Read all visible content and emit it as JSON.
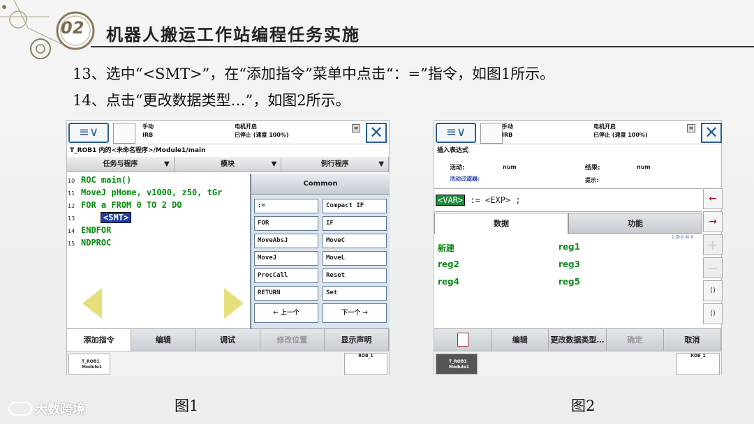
{
  "slide": {
    "section_number": "02",
    "title": "机器人搬运工作站编程任务实施",
    "steps": [
      "13、选中“<SMT>”，在“添加指令”菜单中点击“：=”指令，如图1所示。",
      "14、点击“更改数据类型…”，如图2所示。"
    ],
    "captions": [
      "图1",
      "图2"
    ],
    "watermark": "大数跨境"
  },
  "fig1": {
    "status_mode": "手动",
    "status_mode_sub": "IRB",
    "status_motor": "电机开启",
    "status_state": "已停止 (速度 100%)",
    "breadcrumb": "T_ROB1 内的<未命名程序>/Module1/main",
    "tabs": [
      "任务与程序",
      "模块",
      "例行程序"
    ],
    "code_lines": [
      {
        "num": "10",
        "text": "ROC main()"
      },
      {
        "num": "11",
        "text": " MoveJ pHome, v1000, z50, tGr"
      },
      {
        "num": "12",
        "text": " FOR a FROM 0 TO 2 DO"
      },
      {
        "num": "13",
        "text": "<SMT>"
      },
      {
        "num": "14",
        "text": " ENDFOR"
      },
      {
        "num": "15",
        "text": "NDPROC"
      }
    ],
    "popup_title": "Common",
    "commands": [
      ":=",
      "Compact IF",
      "FOR",
      "IF",
      "MoveAbsJ",
      "MoveC",
      "MoveJ",
      "MoveL",
      "ProcCall",
      "Reset",
      "RETURN",
      "Set"
    ],
    "prev_btn": "←  上一个",
    "next_btn": "下一个 →",
    "bottom": [
      "添加指令",
      "编辑",
      "调试",
      "修改位置",
      "显示声明"
    ],
    "task_label": "T_ROB1\nModule1",
    "robot_label": "ROB_1"
  },
  "fig2": {
    "status_mode": "手动",
    "status_mode_sub": "IRB",
    "status_motor": "电机开启",
    "status_state": "已停止 (速度 100%)",
    "breadcrumb": "插入表达式",
    "activity_label": "活动:",
    "activity_value": "num",
    "result_label": "结果:",
    "result_value": "num",
    "filter_label": "活动过滤器:",
    "hint_label": "提示:",
    "expression_var": "<VAR>",
    "expression_rest": ":= <EXP> ;",
    "tab_data": "数据",
    "tab_func": "功能",
    "page_count": "1 到 6 共 6",
    "items": [
      "新建",
      "reg1",
      "reg2",
      "reg3",
      "reg4",
      "reg5"
    ],
    "side": [
      "←",
      "→",
      "+",
      "−",
      "()",
      "()"
    ],
    "bottom": [
      "编辑",
      "更改数据类型…",
      "确定",
      "取消"
    ],
    "task_label": "T_ROB1\nModule1",
    "robot_label": "ROB_1"
  }
}
